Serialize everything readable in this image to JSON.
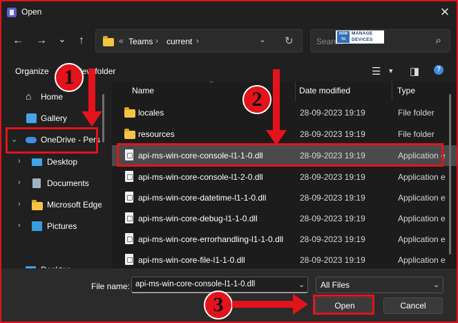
{
  "window": {
    "title": "Open",
    "close_glyph": "✕"
  },
  "nav": {
    "back_glyph": "←",
    "forward_glyph": "→",
    "recent_glyph": "⌄",
    "up_glyph": "↑",
    "breadcrumb": {
      "overflow": "«",
      "items": [
        "Teams",
        "current"
      ],
      "sep": "›"
    },
    "address_dropdown_glyph": "⌄",
    "refresh_glyph": "↻",
    "search_placeholder": "Search",
    "search_glyph": "⌕",
    "logo": {
      "how": "HOW TO",
      "line1": "MANAGE",
      "line2": "DEVICES"
    }
  },
  "command_bar": {
    "organize_label": "Organize",
    "new_folder_label": "New folder",
    "view_glyph": "☰",
    "view_dropdown_glyph": "▾",
    "pane_glyph": "◨",
    "help_glyph": "?"
  },
  "sidebar": {
    "items": [
      {
        "label": "Home",
        "icon": "home-icon"
      },
      {
        "label": "Gallery",
        "icon": "gallery-icon"
      },
      {
        "label": "OneDrive - Pers",
        "icon": "cloud-icon",
        "chevron": "⌄"
      },
      {
        "label": "Desktop",
        "icon": "desktop-icon",
        "chevron": "›"
      },
      {
        "label": "Documents",
        "icon": "documents-icon",
        "chevron": "›"
      },
      {
        "label": "Microsoft Edge",
        "icon": "folder-icon",
        "chevron": "›"
      },
      {
        "label": "Pictures",
        "icon": "pictures-icon",
        "chevron": "›"
      },
      {
        "label": "Desktop",
        "icon": "desktop-icon",
        "chevron": ""
      }
    ]
  },
  "file_list": {
    "columns": {
      "name": "Name",
      "date": "Date modified",
      "type": "Type"
    },
    "sort_glyph": "⌃",
    "rows": [
      {
        "name": "locales",
        "date": "28-09-2023 19:19",
        "type": "File folder",
        "icon": "folder-icon"
      },
      {
        "name": "resources",
        "date": "28-09-2023 19:19",
        "type": "File folder",
        "icon": "folder-icon"
      },
      {
        "name": "api-ms-win-core-console-l1-1-0.dll",
        "date": "28-09-2023 19:19",
        "type": "Application e",
        "icon": "dll-file-icon",
        "selected": true
      },
      {
        "name": "api-ms-win-core-console-l1-2-0.dll",
        "date": "28-09-2023 19:19",
        "type": "Application e",
        "icon": "dll-file-icon"
      },
      {
        "name": "api-ms-win-core-datetime-l1-1-0.dll",
        "date": "28-09-2023 19:19",
        "type": "Application e",
        "icon": "dll-file-icon"
      },
      {
        "name": "api-ms-win-core-debug-l1-1-0.dll",
        "date": "28-09-2023 19:19",
        "type": "Application e",
        "icon": "dll-file-icon"
      },
      {
        "name": "api-ms-win-core-errorhandling-l1-1-0.dll",
        "date": "28-09-2023 19:19",
        "type": "Application e",
        "icon": "dll-file-icon"
      },
      {
        "name": "api-ms-win-core-file-l1-1-0.dll",
        "date": "28-09-2023 19:19",
        "type": "Application e",
        "icon": "dll-file-icon"
      }
    ]
  },
  "footer": {
    "file_name_label": "File name:",
    "file_name_value": "api-ms-win-core-console-l1-1-0.dll",
    "dropdown_glyph": "⌄",
    "file_type_value": "All Files",
    "open_label": "Open",
    "cancel_label": "Cancel"
  },
  "annotations": {
    "step1": "1",
    "step2": "2",
    "step3": "3",
    "color": "#e3131b"
  },
  "colors": {
    "window_bg": "#202020",
    "footer_bg": "#2b2b2b",
    "selection_bg": "#4a4a4a",
    "folder": "#f4c542",
    "accent_blue": "#3e8be0"
  }
}
